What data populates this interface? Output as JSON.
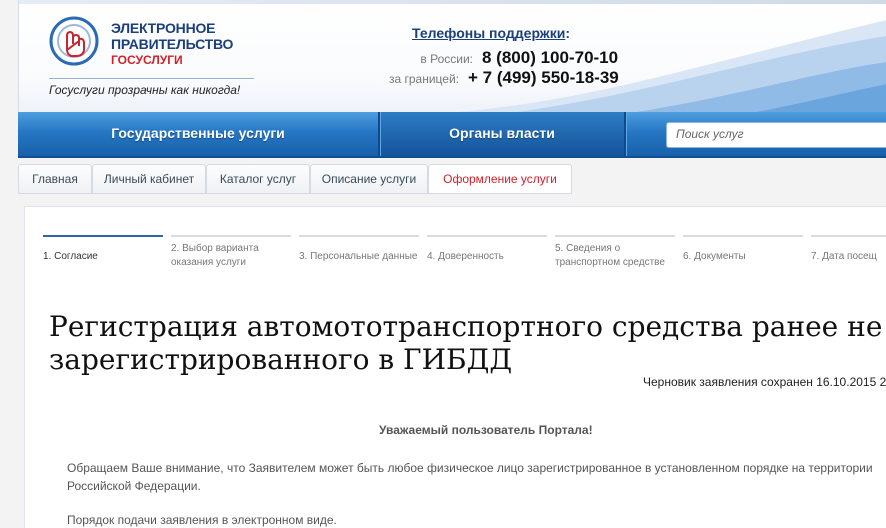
{
  "header": {
    "logo_line1": "ЭЛЕКТРОННОЕ",
    "logo_line2": "ПРАВИТЕЛЬСТВО",
    "logo_line3": "ГОСУСЛУГИ",
    "slogan": "Госуслуги прозрачны как никогда!",
    "phones_title": "Телефоны поддержки",
    "phones_colon": ":",
    "phone_russia_label": "в России:",
    "phone_russia": "8 (800) 100-70-10",
    "phone_abroad_label": "за границей:",
    "phone_abroad": "+ 7 (499) 550-18-39"
  },
  "nav": {
    "items": [
      "Государственные услуги",
      "Органы власти"
    ],
    "search_placeholder": "Поиск услуг"
  },
  "breadcrumbs": [
    "Главная",
    "Личный кабинет",
    "Каталог услуг",
    "Описание услуги",
    "Оформление услуги"
  ],
  "steps": [
    {
      "line1": "1. Согласие",
      "line2": ""
    },
    {
      "line1": "2. Выбор варианта",
      "line2": "оказания услуги"
    },
    {
      "line1": "3. Персональные данные",
      "line2": ""
    },
    {
      "line1": "4. Доверенность",
      "line2": ""
    },
    {
      "line1": "5. Сведения о",
      "line2": "транспортном средстве"
    },
    {
      "line1": "6. Документы",
      "line2": ""
    },
    {
      "line1": "7. Дата посещ",
      "line2": ""
    }
  ],
  "main": {
    "title": "Регистрация автомототранспортного средства ранее не зарегистрированного в ГИБДД",
    "draft_saved": "Черновик заявления сохранен 16.10.2015 2",
    "greeting": "Уважаемый пользователь Портала!",
    "notice": "Обращаем Ваше внимание, что Заявителем может быть любое физическое лицо зарегистрированное в установленном порядке на территории Российской Федерации.",
    "order": "Порядок подачи заявления в электронном виде."
  },
  "colors": {
    "brand_blue": "#1b3f7a",
    "nav_blue": "#2677c4",
    "accent_red": "#d1202a"
  }
}
